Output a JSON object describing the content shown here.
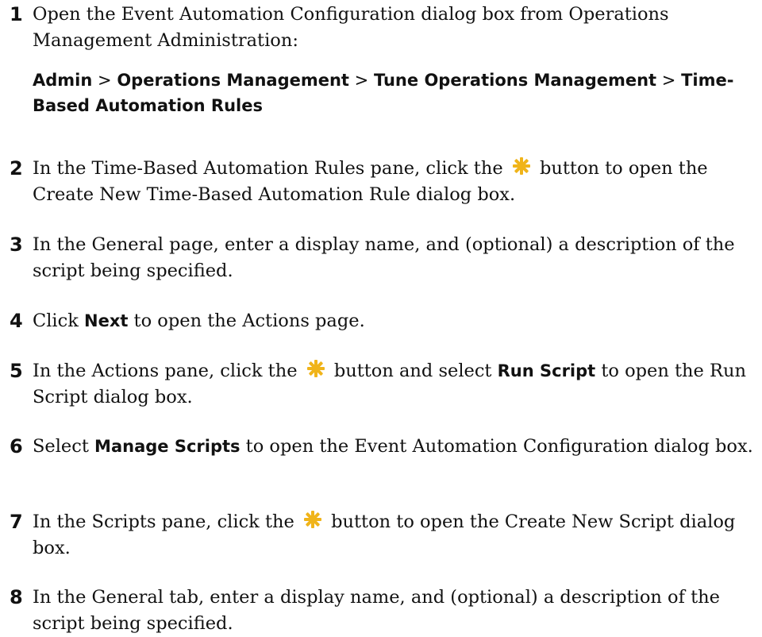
{
  "steps": [
    {
      "number": "1",
      "parts": [
        {
          "t": "Open the Event Automation Configuration dialog box from Operations Management Administration:"
        }
      ]
    },
    {
      "number": "2",
      "parts": [
        {
          "t": "In the Time-Based Automation Rules pane, click the "
        },
        {
          "icon": "new-star-icon"
        },
        {
          "t": " button to open the Create New Time-Based Automation Rule dialog box."
        }
      ]
    },
    {
      "number": "3",
      "parts": [
        {
          "t": "In the General page, enter a display name, and (optional) a description of the script being specified."
        }
      ]
    },
    {
      "number": "4",
      "parts": [
        {
          "t": "Click "
        },
        {
          "b": "Next"
        },
        {
          "t": " to open the Actions page."
        }
      ]
    },
    {
      "number": "5",
      "parts": [
        {
          "t": "In the Actions pane, click the "
        },
        {
          "icon": "new-star-icon"
        },
        {
          "t": " button and select "
        },
        {
          "b": "Run Script"
        },
        {
          "t": " to open the Run Script dialog box."
        }
      ]
    },
    {
      "number": "6",
      "parts": [
        {
          "t": "Select "
        },
        {
          "b": "Manage Scripts"
        },
        {
          "t": " to open the Event Automation Configuration dialog box."
        }
      ]
    },
    {
      "number": "7",
      "parts": [
        {
          "t": "In the Scripts pane, click the "
        },
        {
          "icon": "new-star-icon"
        },
        {
          "t": " button to open the Create New Script dialog box."
        }
      ]
    },
    {
      "number": "8",
      "parts": [
        {
          "t": "In the General tab, enter a display name, and (optional) a description of the script being specified."
        }
      ]
    }
  ],
  "nav_path": {
    "items": [
      "Admin",
      "Operations Management",
      "Tune Operations Management",
      "Time-Based Automation Rules"
    ],
    "separator": ">"
  },
  "colors": {
    "text": "#111111",
    "star_icon": "#f0b41a"
  }
}
